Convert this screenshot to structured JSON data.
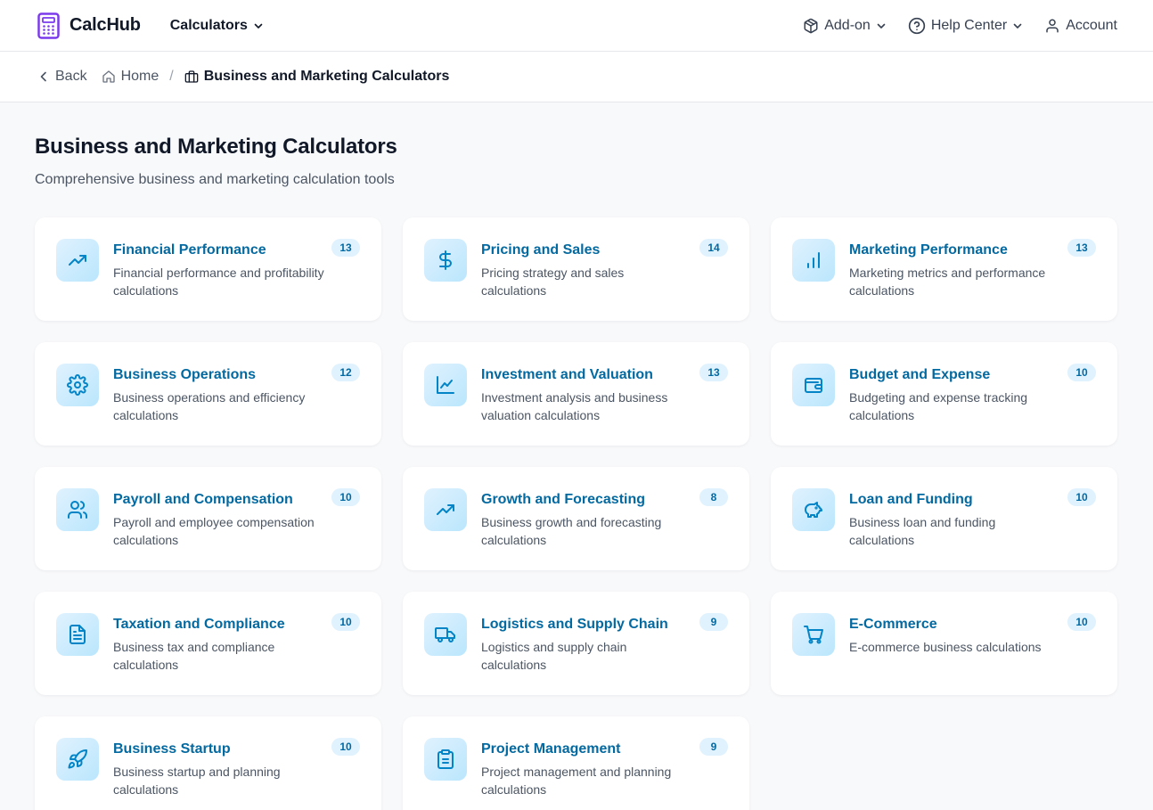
{
  "brand": {
    "name": "CalcHub",
    "accent": "#7c3aed"
  },
  "nav": {
    "calculators": "Calculators",
    "addon": "Add-on",
    "help": "Help Center",
    "account": "Account"
  },
  "breadcrumb": {
    "back": "Back",
    "home": "Home",
    "separator": "/",
    "current": "Business and Marketing Calculators"
  },
  "page": {
    "title": "Business and Marketing Calculators",
    "subtitle": "Comprehensive business and marketing calculation tools"
  },
  "colors": {
    "link": "#0369a1",
    "icon": "#0284c7",
    "badge_bg": "#e0f2fe"
  },
  "categories": [
    {
      "title": "Financial Performance",
      "desc": "Financial performance and profitability calculations",
      "count": "13",
      "icon": "trending-up-icon"
    },
    {
      "title": "Pricing and Sales",
      "desc": "Pricing strategy and sales calculations",
      "count": "14",
      "icon": "dollar-icon"
    },
    {
      "title": "Marketing Performance",
      "desc": "Marketing metrics and performance calculations",
      "count": "13",
      "icon": "bar-chart-icon"
    },
    {
      "title": "Business Operations",
      "desc": "Business operations and efficiency calculations",
      "count": "12",
      "icon": "gear-icon"
    },
    {
      "title": "Investment and Valuation",
      "desc": "Investment analysis and business valuation calculations",
      "count": "13",
      "icon": "line-chart-icon"
    },
    {
      "title": "Budget and Expense",
      "desc": "Budgeting and expense tracking calculations",
      "count": "10",
      "icon": "wallet-icon"
    },
    {
      "title": "Payroll and Compensation",
      "desc": "Payroll and employee compensation calculations",
      "count": "10",
      "icon": "users-icon"
    },
    {
      "title": "Growth and Forecasting",
      "desc": "Business growth and forecasting calculations",
      "count": "8",
      "icon": "trending-up-icon"
    },
    {
      "title": "Loan and Funding",
      "desc": "Business loan and funding calculations",
      "count": "10",
      "icon": "piggy-bank-icon"
    },
    {
      "title": "Taxation and Compliance",
      "desc": "Business tax and compliance calculations",
      "count": "10",
      "icon": "document-icon"
    },
    {
      "title": "Logistics and Supply Chain",
      "desc": "Logistics and supply chain calculations",
      "count": "9",
      "icon": "truck-icon"
    },
    {
      "title": "E-Commerce",
      "desc": "E-commerce business calculations",
      "count": "10",
      "icon": "cart-icon"
    },
    {
      "title": "Business Startup",
      "desc": "Business startup and planning calculations",
      "count": "10",
      "icon": "rocket-icon"
    },
    {
      "title": "Project Management",
      "desc": "Project management and planning calculations",
      "count": "9",
      "icon": "clipboard-icon"
    }
  ]
}
